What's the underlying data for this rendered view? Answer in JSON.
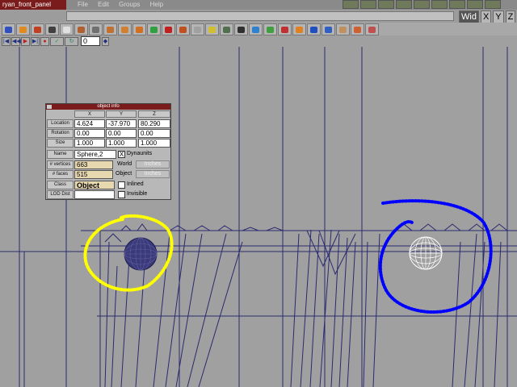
{
  "app": {
    "title": "ryan_front_panel"
  },
  "menu": [
    "File",
    "Edit",
    "Groups",
    "Help"
  ],
  "axes": {
    "view_label": "Wid",
    "x": "X",
    "y": "Y",
    "z": "Z"
  },
  "playback": {
    "frame": "0"
  },
  "object_info": {
    "title": "object info",
    "col_x": "X",
    "col_y": "Y",
    "col_z": "Z",
    "location_label": "Location",
    "location": {
      "x": "4.624",
      "y": "-37.970",
      "z": "80.290"
    },
    "rotation_label": "Rotation",
    "rotation": {
      "x": "0.00",
      "y": "0.00",
      "z": "0.00"
    },
    "size_label": "Size",
    "size": {
      "x": "1.000",
      "y": "1.000",
      "z": "1.000"
    },
    "name_label": "Name",
    "name": "Sphere,2",
    "dynaunits_label": "Dynaunits",
    "dynaunits_checked": "X",
    "vertices_label": "# vertices",
    "vertices": "663",
    "world_label": "World",
    "world_units": "Inches",
    "faces_label": "# faces",
    "faces": "515",
    "object_label": "Object",
    "object_units": "Inches",
    "class_label": "Class",
    "class": "Object",
    "inlined_label": "Inlined",
    "lod_label": "LOD Dist",
    "lod": "",
    "invisible_label": "Invisible"
  },
  "annotations": {
    "left_circle_color": "#ffff00",
    "right_circle_color": "#0000ff"
  },
  "wire_color": "#2a2a70"
}
